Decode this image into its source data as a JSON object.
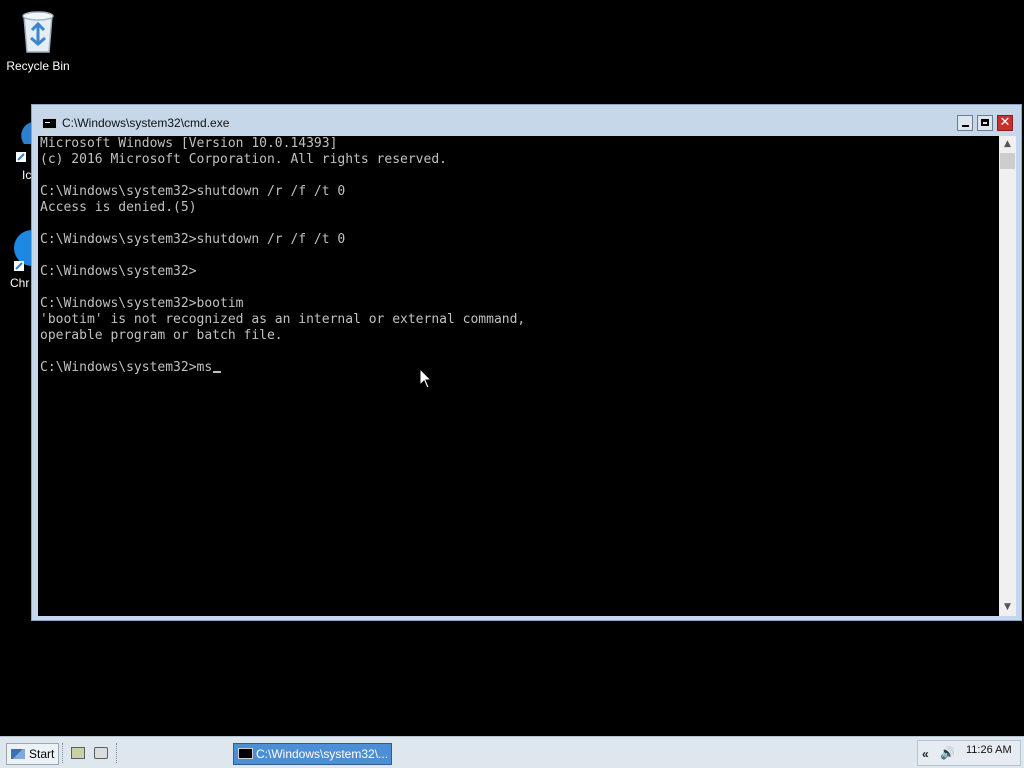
{
  "desktop": {
    "icons": [
      {
        "label": "Recycle Bin"
      },
      {
        "label": "Ic"
      },
      {
        "label": "Chr"
      }
    ]
  },
  "window": {
    "title": "C:\\Windows\\system32\\cmd.exe",
    "controls": {
      "minimize": "minimize",
      "maximize": "maximize",
      "close": "✕"
    },
    "console_lines": [
      "Microsoft Windows [Version 10.0.14393]",
      "(c) 2016 Microsoft Corporation. All rights reserved.",
      "",
      "C:\\Windows\\system32>shutdown /r /f /t 0",
      "Access is denied.(5)",
      "",
      "C:\\Windows\\system32>shutdown /r /f /t 0",
      "",
      "C:\\Windows\\system32>",
      "",
      "C:\\Windows\\system32>bootim",
      "'bootim' is not recognized as an internal or external command,",
      "operable program or batch file.",
      "",
      "C:\\Windows\\system32>ms"
    ]
  },
  "taskbar": {
    "start_label": "Start",
    "task_button_label": "C:\\Windows\\system32\\...",
    "tray": {
      "clock": "11:26 AM",
      "chevron": "«",
      "volume_glyph": "🔊"
    }
  },
  "icons": {
    "start": "windows-flag-icon",
    "quicklaunch": [
      "server-manager-icon",
      "powershell-icon"
    ],
    "window": "cmd-icon"
  }
}
